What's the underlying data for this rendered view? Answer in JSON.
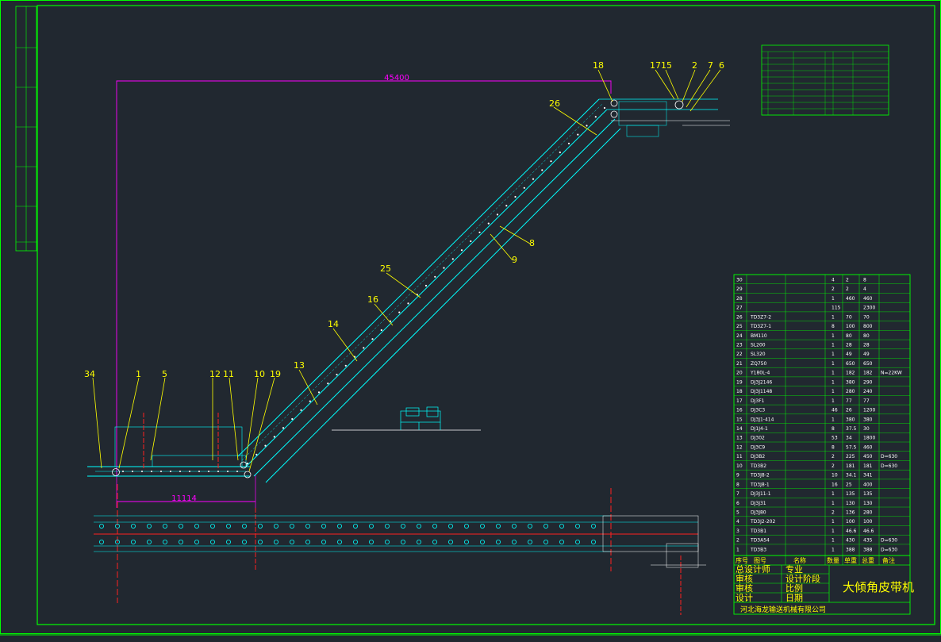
{
  "drawing_title": "大倾角皮带机",
  "company": "河北海龙输送机械有限公司",
  "dimensions": {
    "horizontal_total": "45400",
    "lower_horizontal": "11114"
  },
  "part_callouts": [
    "34",
    "1",
    "5",
    "12",
    "11",
    "10",
    "19",
    "13",
    "14",
    "16",
    "25",
    "26",
    "18",
    "17",
    "15",
    "2",
    "7",
    "6",
    "8",
    "9"
  ],
  "parts_list": {
    "rows": [
      {
        "no": "30",
        "drawing": "",
        "name": "",
        "qty": "4",
        "unit": "2",
        "total": "8",
        "remark": ""
      },
      {
        "no": "29",
        "drawing": "",
        "name": "",
        "qty": "2",
        "unit": "2",
        "total": "4",
        "remark": ""
      },
      {
        "no": "28",
        "drawing": "",
        "name": "",
        "qty": "1",
        "unit": "460",
        "total": "460",
        "remark": ""
      },
      {
        "no": "27",
        "drawing": "",
        "name": "",
        "qty": "115",
        "unit": "",
        "total": "2300",
        "remark": ""
      },
      {
        "no": "26",
        "drawing": "TD3Z7-2",
        "name": "",
        "qty": "1",
        "unit": "70",
        "total": "70",
        "remark": ""
      },
      {
        "no": "25",
        "drawing": "TD3Z7-1",
        "name": "",
        "qty": "8",
        "unit": "100",
        "total": "800",
        "remark": ""
      },
      {
        "no": "24",
        "drawing": "BM110",
        "name": "",
        "qty": "1",
        "unit": "80",
        "total": "80",
        "remark": ""
      },
      {
        "no": "23",
        "drawing": "SL200",
        "name": "",
        "qty": "1",
        "unit": "28",
        "total": "28",
        "remark": ""
      },
      {
        "no": "22",
        "drawing": "SL320",
        "name": "",
        "qty": "1",
        "unit": "49",
        "total": "49",
        "remark": ""
      },
      {
        "no": "21",
        "drawing": "ZQ750",
        "name": "",
        "qty": "1",
        "unit": "650",
        "total": "650",
        "remark": ""
      },
      {
        "no": "20",
        "drawing": "Y180L-4",
        "name": "",
        "qty": "1",
        "unit": "182",
        "total": "182",
        "remark": "N=22KW"
      },
      {
        "no": "19",
        "drawing": "DJ3J2146",
        "name": "",
        "qty": "1",
        "unit": "380",
        "total": "290",
        "remark": ""
      },
      {
        "no": "18",
        "drawing": "DJ3J1148",
        "name": "",
        "qty": "1",
        "unit": "280",
        "total": "240",
        "remark": ""
      },
      {
        "no": "17",
        "drawing": "DJ3F1",
        "name": "",
        "qty": "1",
        "unit": "77",
        "total": "77",
        "remark": ""
      },
      {
        "no": "16",
        "drawing": "DJ3C3",
        "name": "",
        "qty": "46",
        "unit": "26",
        "total": "1200",
        "remark": ""
      },
      {
        "no": "15",
        "drawing": "DJ3J1-414",
        "name": "",
        "qty": "1",
        "unit": "380",
        "total": "380",
        "remark": ""
      },
      {
        "no": "14",
        "drawing": "DJ1J4-1",
        "name": "",
        "qty": "8",
        "unit": "37.5",
        "total": "30",
        "remark": ""
      },
      {
        "no": "13",
        "drawing": "DJ302",
        "name": "",
        "qty": "53",
        "unit": "34",
        "total": "1800",
        "remark": ""
      },
      {
        "no": "12",
        "drawing": "DJ3C9",
        "name": "",
        "qty": "8",
        "unit": "57.5",
        "total": "460",
        "remark": ""
      },
      {
        "no": "11",
        "drawing": "DJ3B2",
        "name": "",
        "qty": "2",
        "unit": "225",
        "total": "450",
        "remark": "D=630"
      },
      {
        "no": "10",
        "drawing": "TD3B2",
        "name": "",
        "qty": "2",
        "unit": "181",
        "total": "181",
        "remark": "D=630"
      },
      {
        "no": "9",
        "drawing": "TD3J8-2",
        "name": "",
        "qty": "10",
        "unit": "34.1",
        "total": "341",
        "remark": ""
      },
      {
        "no": "8",
        "drawing": "TD3J8-1",
        "name": "",
        "qty": "16",
        "unit": "25",
        "total": "400",
        "remark": ""
      },
      {
        "no": "7",
        "drawing": "DJ3J11-1",
        "name": "",
        "qty": "1",
        "unit": "135",
        "total": "135",
        "remark": ""
      },
      {
        "no": "6",
        "drawing": "DJ3J31",
        "name": "",
        "qty": "1",
        "unit": "130",
        "total": "130",
        "remark": ""
      },
      {
        "no": "5",
        "drawing": "DJ3J80",
        "name": "",
        "qty": "2",
        "unit": "136",
        "total": "280",
        "remark": ""
      },
      {
        "no": "4",
        "drawing": "TD3J2-202",
        "name": "",
        "qty": "1",
        "unit": "100",
        "total": "100",
        "remark": ""
      },
      {
        "no": "3",
        "drawing": "TD3B1",
        "name": "",
        "qty": "1",
        "unit": "46.6",
        "total": "46.6",
        "remark": ""
      },
      {
        "no": "2",
        "drawing": "TD3A54",
        "name": "",
        "qty": "1",
        "unit": "430",
        "total": "435",
        "remark": "D=630"
      },
      {
        "no": "1",
        "drawing": "TD3B3",
        "name": "",
        "qty": "1",
        "unit": "388",
        "total": "388",
        "remark": "D=630"
      }
    ],
    "header": [
      "序号",
      "图号",
      "名称",
      "数量",
      "单重",
      "总重",
      "备注"
    ]
  },
  "title_block": {
    "labels": [
      "总设计师",
      "专业",
      "审核",
      "设计阶段",
      "审核",
      "比例",
      "设计",
      "日期"
    ]
  },
  "colors": {
    "bg": "#212830",
    "frame": "#00ff00",
    "belt": "#00ffff",
    "dim": "#ff00ff",
    "leader": "#ffff00",
    "center": "#ff2020"
  }
}
